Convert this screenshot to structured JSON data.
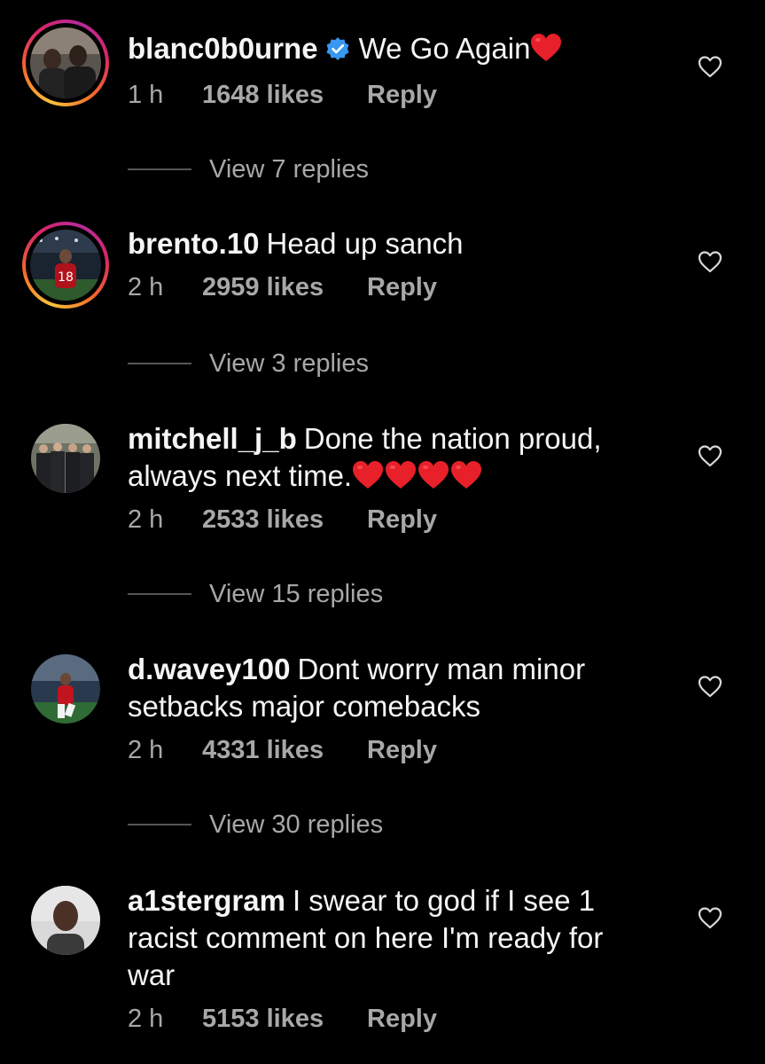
{
  "comments": [
    {
      "username": "blanc0b0urne",
      "verified": true,
      "text": "We Go Again",
      "emoji": "❤️",
      "time": "1 h",
      "likes": "1648 likes",
      "reply_label": "Reply",
      "view_replies": "View 7 replies",
      "story_ring": true,
      "like_icon": "heart-outline-icon"
    },
    {
      "username": "brento.10",
      "verified": false,
      "text": "Head up sanch",
      "time": "2 h",
      "likes": "2959 likes",
      "reply_label": "Reply",
      "view_replies": "View 3 replies",
      "story_ring": true,
      "like_icon": "heart-outline-icon"
    },
    {
      "username": "mitchell_j_b",
      "verified": false,
      "text": "Done the nation proud, always next time.",
      "emoji": "❤️❤️❤️❤️",
      "time": "2 h",
      "likes": "2533 likes",
      "reply_label": "Reply",
      "view_replies": "View 15 replies",
      "story_ring": false,
      "like_icon": "heart-outline-icon"
    },
    {
      "username": "d.wavey100",
      "verified": false,
      "text": "Dont worry man minor setbacks major comebacks",
      "time": "2 h",
      "likes": "4331 likes",
      "reply_label": "Reply",
      "view_replies": "View 30 replies",
      "story_ring": false,
      "like_icon": "heart-outline-icon"
    },
    {
      "username": "a1stergram",
      "verified": false,
      "text": "I swear to god if I see 1 racist comment on here I'm ready for war",
      "time": "2 h",
      "likes": "5153 likes",
      "reply_label": "Reply",
      "story_ring": false,
      "like_icon": "heart-outline-icon"
    }
  ],
  "avatar_photo_18_text": "18",
  "colors": {
    "background": "#000000",
    "primary_text": "#f5f5f5",
    "secondary_text": "#a8a8a8",
    "verified_badge": "#3897f0",
    "heart_emoji": "#e8202a"
  }
}
